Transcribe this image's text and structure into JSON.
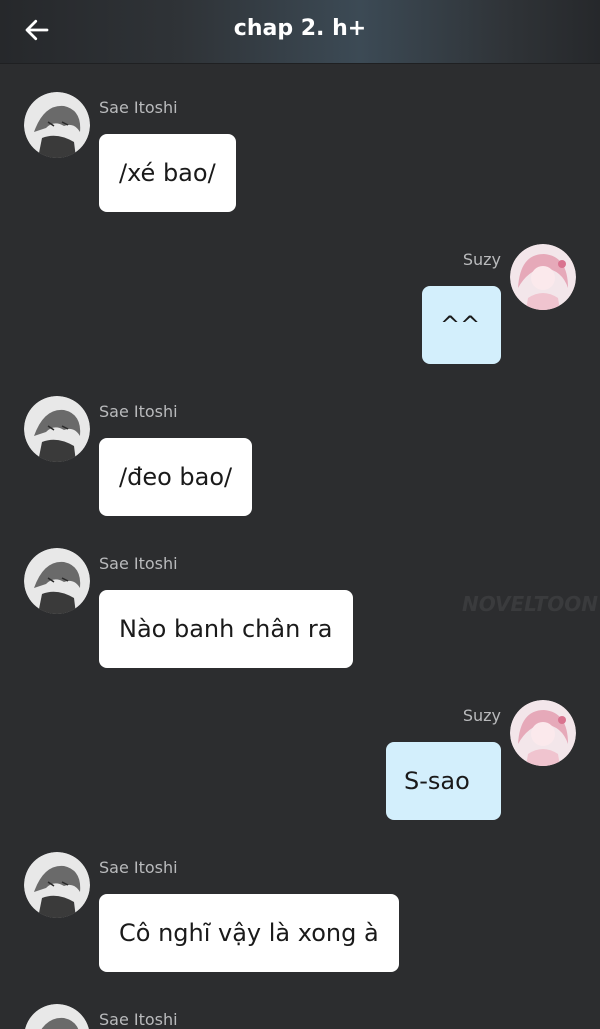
{
  "header": {
    "title": "chap 2. h+",
    "back_icon": "arrow-left-icon"
  },
  "colors": {
    "background": "#2c2d2f",
    "left_bubble": "#ffffff",
    "right_bubble": "#d3effc",
    "sender_text": "#b9babc"
  },
  "watermark": "NOVELTOON",
  "messages": [
    {
      "sender": "Sae Itoshi",
      "side": "left",
      "text": "/xé bao/"
    },
    {
      "sender": "Suzy",
      "side": "right",
      "text": "^^"
    },
    {
      "sender": "Sae Itoshi",
      "side": "left",
      "text": "/đeo bao/"
    },
    {
      "sender": "Sae Itoshi",
      "side": "left",
      "text": "Nào banh chân ra"
    },
    {
      "sender": "Suzy",
      "side": "right",
      "text": "S-sao"
    },
    {
      "sender": "Sae Itoshi",
      "side": "left",
      "text": "Cô nghĩ vậy là xong à"
    },
    {
      "sender": "Sae Itoshi",
      "side": "left",
      "text": ""
    }
  ]
}
